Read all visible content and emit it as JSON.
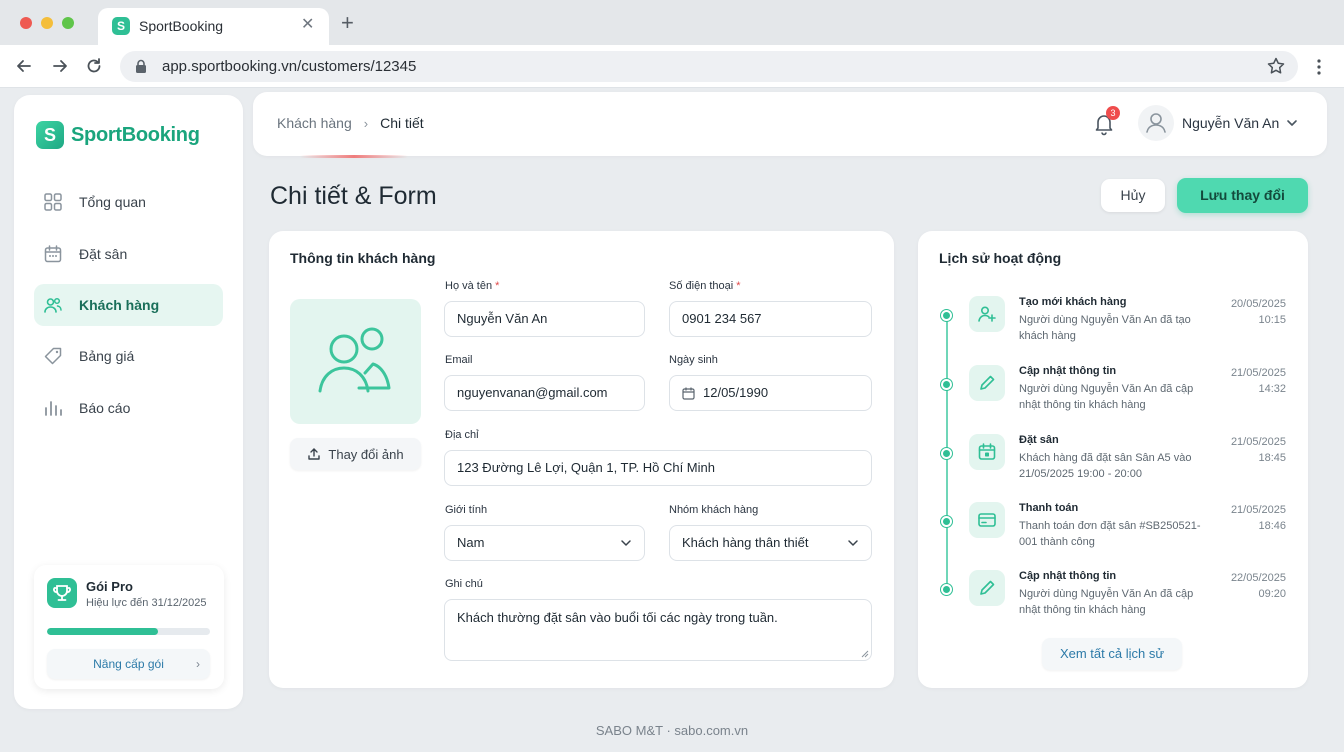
{
  "browser": {
    "tab_title": "SportBooking",
    "favicon_letter": "S",
    "url": "app.sportbooking.vn/customers/12345"
  },
  "sidebar": {
    "logo_letter": "S",
    "logo_text": "SportBooking",
    "items": [
      {
        "label": "Tổng quan",
        "icon": "grid-icon",
        "active": false
      },
      {
        "label": "Đặt sân",
        "icon": "calendar-icon",
        "active": false
      },
      {
        "label": "Khách hàng",
        "icon": "users-icon",
        "active": true
      },
      {
        "label": "Bảng giá",
        "icon": "tag-icon",
        "active": false
      },
      {
        "label": "Báo cáo",
        "icon": "bar-chart-icon",
        "active": false
      }
    ],
    "plan": {
      "title": "Gói Pro",
      "subtitle": "Hiệu lực đến 31/12/2025",
      "progress": 0.68,
      "upgrade_label": "Nâng cấp gói"
    }
  },
  "header": {
    "breadcrumb": [
      "Khách hàng",
      "Chi tiết"
    ],
    "notification_count": "3",
    "user_name": "Nguyễn Văn An"
  },
  "page": {
    "title": "Chi tiết & Form",
    "cancel_label": "Hủy",
    "save_label": "Lưu thay đổi"
  },
  "form": {
    "title": "Thông tin khách hàng",
    "change_photo_label": "Thay đổi ảnh",
    "fields": {
      "full_name": {
        "label": "Họ và tên",
        "required": "*",
        "value": "Nguyễn Văn An"
      },
      "phone": {
        "label": "Số điện thoại",
        "required": "*",
        "value": "0901 234 567"
      },
      "email": {
        "label": "Email",
        "value": "nguyenvanan@gmail.com"
      },
      "birthday": {
        "label": "Ngày sinh",
        "value": "12/05/1990"
      },
      "address": {
        "label": "Địa chỉ",
        "value": "123 Đường Lê Lợi, Quận 1, TP. Hồ Chí Minh"
      },
      "gender": {
        "label": "Giới tính",
        "value": "Nam"
      },
      "group": {
        "label": "Nhóm khách hàng",
        "value": "Khách hàng thân thiết"
      },
      "note": {
        "label": "Ghi chú",
        "value": "Khách thường đặt sân vào buổi tối các ngày trong tuần."
      }
    }
  },
  "history": {
    "title": "Lịch sử hoạt động",
    "items": [
      {
        "title": "Tạo mới khách hàng",
        "desc": "Người dùng Nguyễn Văn An đã tạo khách hàng",
        "date": "20/05/2025",
        "time": "10:15",
        "icon": "user-plus-icon"
      },
      {
        "title": "Cập nhật thông tin",
        "desc": "Người dùng Nguyễn Văn An đã cập nhật thông tin khách hàng",
        "date": "21/05/2025",
        "time": "14:32",
        "icon": "pencil-icon"
      },
      {
        "title": "Đặt sân",
        "desc": "Khách hàng đã đặt sân Sân A5 vào 21/05/2025 19:00 - 20:00",
        "date": "21/05/2025",
        "time": "18:45",
        "icon": "calendar-icon"
      },
      {
        "title": "Thanh toán",
        "desc": "Thanh toán đơn đặt sân #SB250521-001 thành công",
        "date": "21/05/2025",
        "time": "18:46",
        "icon": "card-icon"
      },
      {
        "title": "Cập nhật thông tin",
        "desc": "Người dùng Nguyễn Văn An đã cập nhật thông tin khách hàng",
        "date": "22/05/2025",
        "time": "09:20",
        "icon": "pencil-icon"
      }
    ],
    "view_all_label": "Xem tất cả lịch sử"
  },
  "footer": {
    "text": "SABO M&T · sabo.com.vn"
  },
  "colors": {
    "accent": "#2fbf95",
    "accent_light": "#e3f5ef",
    "danger": "#ef4c4c"
  }
}
